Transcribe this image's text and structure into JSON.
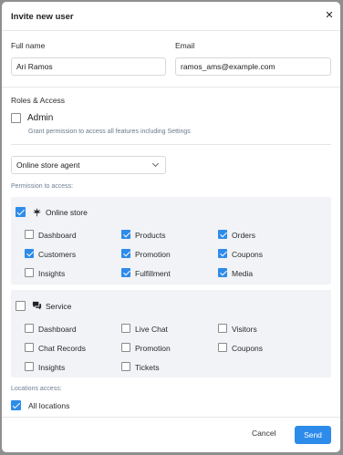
{
  "dialog": {
    "title": "Invite new user",
    "close_icon": "close-icon"
  },
  "form": {
    "full_name_label": "Full name",
    "full_name_value": "Ari Ramos",
    "email_label": "Email",
    "email_value": "ramos_ams@example.com"
  },
  "roles": {
    "heading": "Roles & Access",
    "admin_label": "Admin",
    "admin_checked": false,
    "admin_hint": "Grant permission to access all features including Settings",
    "role_select_value": "Online store agent"
  },
  "permissions": {
    "heading": "Permission to access:",
    "groups": [
      {
        "name": "Online store",
        "icon": "cannabis-leaf-icon",
        "checked": true,
        "items": [
          {
            "label": "Dashboard",
            "checked": false
          },
          {
            "label": "Products",
            "checked": true
          },
          {
            "label": "Orders",
            "checked": true
          },
          {
            "label": "Customers",
            "checked": true
          },
          {
            "label": "Promotion",
            "checked": true
          },
          {
            "label": "Coupons",
            "checked": true
          },
          {
            "label": "Insights",
            "checked": false
          },
          {
            "label": "Fulfillment",
            "checked": true
          },
          {
            "label": "Media",
            "checked": true
          }
        ]
      },
      {
        "name": "Service",
        "icon": "chat-bubbles-icon",
        "checked": false,
        "items": [
          {
            "label": "Dashboard",
            "checked": false
          },
          {
            "label": "Live Chat",
            "checked": false
          },
          {
            "label": "Visitors",
            "checked": false
          },
          {
            "label": "Chat Records",
            "checked": false
          },
          {
            "label": "Promotion",
            "checked": false
          },
          {
            "label": "Coupons",
            "checked": false
          },
          {
            "label": "Insights",
            "checked": false
          },
          {
            "label": "Tickets",
            "checked": false
          }
        ]
      }
    ]
  },
  "locations": {
    "heading": "Locations access:",
    "all_label": "All locations",
    "all_checked": true
  },
  "footer": {
    "cancel_label": "Cancel",
    "send_label": "Send"
  },
  "colors": {
    "accent": "#2d8bea",
    "panel_bg": "#f1f3f6",
    "overlay": "#8f8f8f"
  }
}
